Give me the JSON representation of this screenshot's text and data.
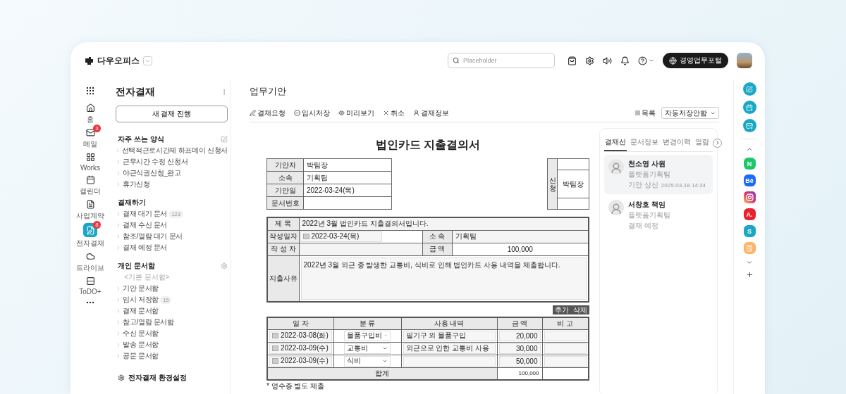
{
  "brand": {
    "name": "다우오피스"
  },
  "search": {
    "placeholder": "Placeholder"
  },
  "portal_button": "경영업무포털",
  "nav": [
    {
      "label": "홈",
      "selected": false
    },
    {
      "label": "메일",
      "badge": "3",
      "selected": false
    },
    {
      "label": "Works",
      "selected": false
    },
    {
      "label": "캘린더",
      "selected": false
    },
    {
      "label": "사업계약",
      "selected": false
    },
    {
      "label": "전자결재",
      "badge": "8",
      "selected": true
    },
    {
      "label": "드라이브",
      "selected": false
    },
    {
      "label": "ToDO+",
      "selected": false
    }
  ],
  "sidebar": {
    "title": "전자결재",
    "new_button": "새 결재 진행",
    "sections": [
      {
        "title": "자주 쓰는 양식",
        "items": [
          {
            "label": "선택적근로시간제 하프데이 신청서"
          },
          {
            "label": "근무시간 수정 신청서"
          },
          {
            "label": "야근식권신청_완고"
          },
          {
            "label": "휴가신청"
          }
        ]
      },
      {
        "title": "결재하기",
        "items": [
          {
            "label": "결재 대기 문서",
            "count": "123"
          },
          {
            "label": "결재 수신 문서"
          },
          {
            "label": "참조/열람 대기 문서"
          },
          {
            "label": "결재 예정 문서"
          }
        ]
      },
      {
        "title": "개인 문서함",
        "note": "<기본 문서함>",
        "items": [
          {
            "label": "기안 문서함"
          },
          {
            "label": "임시 저장함",
            "count": "15"
          },
          {
            "label": "결재 문서함"
          },
          {
            "label": "참고/열람 문서함"
          },
          {
            "label": "수신 문서함"
          },
          {
            "label": "발송 문서함"
          },
          {
            "label": "공문 문서함"
          }
        ]
      }
    ],
    "footer": "전자결재 환경설정"
  },
  "main": {
    "title": "업무기안",
    "toolbar": [
      "결재요청",
      "임시저장",
      "미리보기",
      "취소",
      "결재정보"
    ],
    "list_button": "목록",
    "autosave": "자동저장안함"
  },
  "document": {
    "title": "법인카드 지출결의서",
    "info_rows": [
      {
        "label": "기안자",
        "value": "박팀장"
      },
      {
        "label": "소속",
        "value": "기획팀"
      },
      {
        "label": "기안일",
        "value": "2022-03-24(목)"
      },
      {
        "label": "문서번호"
      }
    ],
    "approval": {
      "side_label": "신청",
      "name": "박팀장"
    },
    "subject": {
      "label": "제 목",
      "value": "2022년 3월 법인카드 지출결의서입니다."
    },
    "write_date": {
      "label": "작성일자",
      "value": "2022-03-24(목)"
    },
    "department": {
      "label": "소 속",
      "value": "기획팀"
    },
    "writer": {
      "label": "작 성 자"
    },
    "amount": {
      "label": "금 액",
      "value": "100,000"
    },
    "reason": {
      "label": "지출사유",
      "value": "2022년 3월 외근 중 발생한 교통비, 식비로 인해 법인카드 사용 내역을 제출합니다."
    },
    "row_buttons": [
      "추가",
      "삭제"
    ],
    "expense_columns": [
      "일 자",
      "분 류",
      "사용 내역",
      "금 액",
      "비 고"
    ],
    "expenses": [
      {
        "date": "2022-03-08(화)",
        "category": "물품구입비",
        "description": "필기구 외 물품구입",
        "amount": "20,000"
      },
      {
        "date": "2022-03-09(수)",
        "category": "교통비",
        "description": "외근으로 인한 교통비 사용",
        "amount": "30,000"
      },
      {
        "date": "2022-03-09(수)",
        "category": "식비",
        "amount": "50,000"
      }
    ],
    "total": {
      "label": "합계",
      "value": "100,000"
    },
    "footnote": "* 영수증 별도 제출"
  },
  "panel": {
    "tabs": [
      {
        "label": "결재선",
        "selected": true
      },
      {
        "label": "문서정보",
        "selected": false
      },
      {
        "label": "변경이력",
        "selected": false
      },
      {
        "label": "열람",
        "selected": false
      }
    ],
    "approvers": [
      {
        "name": "천소영 사원",
        "team": "플랫폼기획팀",
        "status": "기안 상신",
        "time": "2025-03-18 14:34",
        "selected": true
      },
      {
        "name": "서창호 책임",
        "team": "플랫폼기획팀",
        "status": "결재 예정",
        "selected": false
      }
    ]
  },
  "right_rail": {
    "apps": [
      {
        "kind": "letter",
        "label": "N",
        "color": "#1ec86a"
      },
      {
        "kind": "letter",
        "label": "Bē",
        "color": "#1769ff"
      },
      {
        "kind": "instagram"
      },
      {
        "kind": "letter",
        "label": "A.",
        "color": "#e8212b"
      },
      {
        "kind": "letter",
        "label": "S",
        "color": "#19a7c6"
      },
      {
        "kind": "calculator",
        "color": "#fdb466"
      }
    ]
  }
}
